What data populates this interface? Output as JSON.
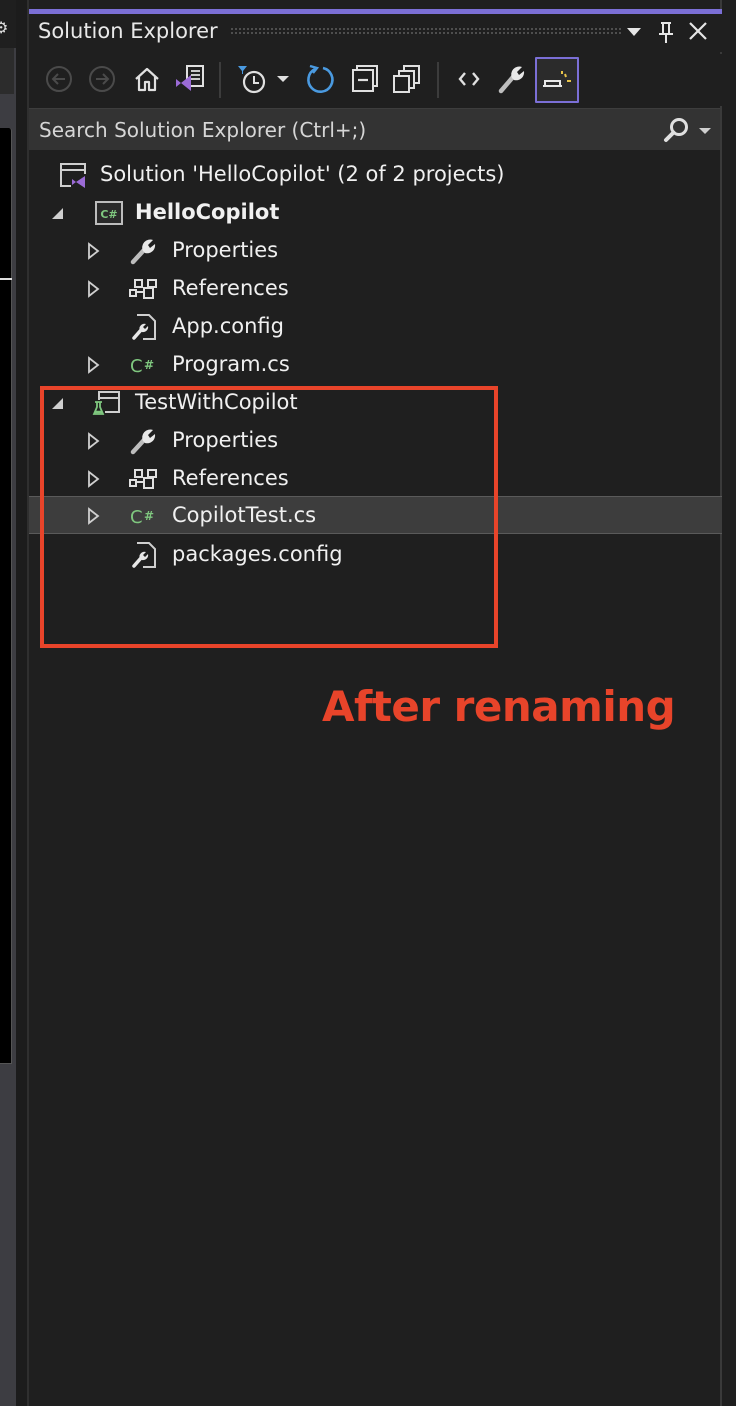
{
  "panel": {
    "title": "Solution Explorer",
    "title_buttons": {
      "dropdown": "window-position-dropdown",
      "pin": "auto-hide-pin",
      "close": "close"
    }
  },
  "toolbar": {
    "buttons": [
      {
        "id": "back",
        "icon": "back-arrow-icon",
        "enabled": false
      },
      {
        "id": "forward",
        "icon": "forward-arrow-icon",
        "enabled": false
      },
      {
        "id": "home",
        "icon": "home-icon",
        "enabled": true
      },
      {
        "id": "switch-views",
        "icon": "switch-views-icon",
        "enabled": true
      },
      {
        "id": "pending-changes-filter",
        "icon": "clock-filter-icon",
        "enabled": true
      },
      {
        "id": "pending-changes-dropdown",
        "icon": "dropdown-caret-icon",
        "enabled": true
      },
      {
        "id": "sync-with-active-document",
        "icon": "refresh-icon",
        "enabled": true
      },
      {
        "id": "collapse-all",
        "icon": "collapse-all-icon",
        "enabled": true
      },
      {
        "id": "show-all-files",
        "icon": "show-all-files-icon",
        "enabled": true
      },
      {
        "id": "view-code",
        "icon": "code-brackets-icon",
        "enabled": true
      },
      {
        "id": "properties",
        "icon": "wrench-icon",
        "enabled": true
      },
      {
        "id": "preview-selected-items",
        "icon": "preview-icon",
        "enabled": true,
        "active": true
      }
    ]
  },
  "search": {
    "placeholder": "Search Solution Explorer (Ctrl+;)",
    "value": ""
  },
  "tree": {
    "solution": {
      "label": "Solution 'HelloCopilot' (2 of 2 projects)",
      "icon": "solution-icon"
    },
    "projects": [
      {
        "label": "HelloCopilot",
        "bold": true,
        "expanded": true,
        "icon": "csharp-project-icon",
        "children": [
          {
            "label": "Properties",
            "icon": "wrench-icon",
            "expandable": true
          },
          {
            "label": "References",
            "icon": "references-icon",
            "expandable": true
          },
          {
            "label": "App.config",
            "icon": "config-file-icon",
            "expandable": false
          },
          {
            "label": "Program.cs",
            "icon": "csharp-file-icon",
            "expandable": true
          }
        ]
      },
      {
        "label": "TestWithCopilot",
        "bold": false,
        "expanded": true,
        "icon": "test-project-icon",
        "children": [
          {
            "label": "Properties",
            "icon": "wrench-icon",
            "expandable": true
          },
          {
            "label": "References",
            "icon": "references-icon",
            "expandable": true
          },
          {
            "label": "CopilotTest.cs",
            "icon": "csharp-file-icon",
            "expandable": true,
            "selected": true
          },
          {
            "label": "packages.config",
            "icon": "config-file-icon",
            "expandable": false
          }
        ]
      }
    ]
  },
  "annotation": {
    "text": "After renaming",
    "color": "#e8442a"
  },
  "colors": {
    "accent": "#7b6fd6",
    "background": "#1f1f1f",
    "search_bg": "#333333",
    "selected_row": "#3d3d3d",
    "csharp_green": "#7fc77f",
    "vs_purple": "#9b6bd6",
    "refresh_blue": "#4a9ae0"
  }
}
